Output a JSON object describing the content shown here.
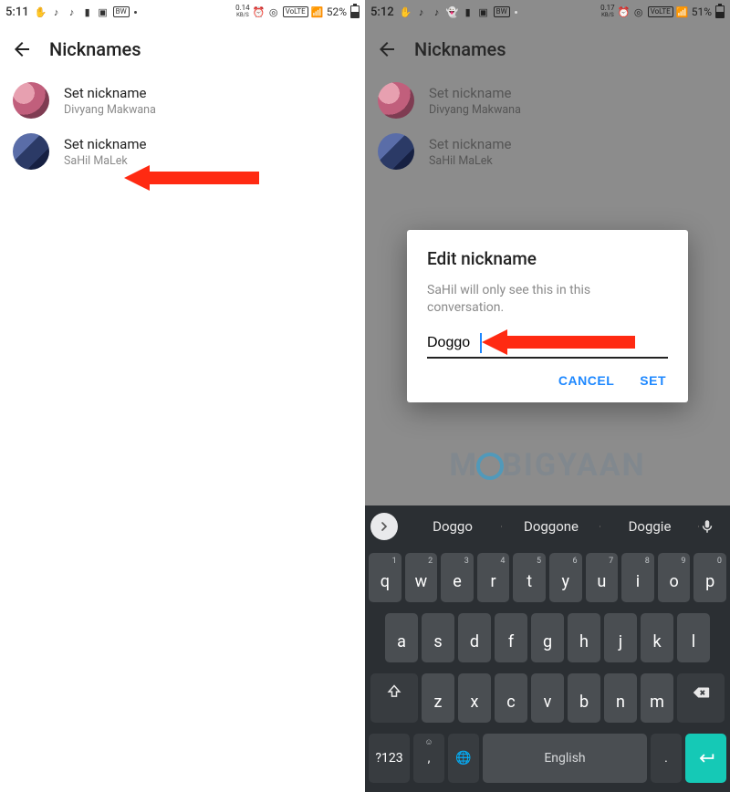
{
  "left": {
    "statusbar": {
      "time": "5:11",
      "rate": "0.14",
      "rate_unit": "KB/S",
      "volte": "VoLTE",
      "battery_pct": "52%",
      "bw": "BW"
    },
    "header": {
      "title": "Nicknames"
    },
    "rows": [
      {
        "title": "Set nickname",
        "sub": "Divyang Makwana"
      },
      {
        "title": "Set nickname",
        "sub": "SaHil MaLek"
      }
    ]
  },
  "right": {
    "statusbar": {
      "time": "5:12",
      "rate": "0.17",
      "rate_unit": "KB/S",
      "volte": "VoLTE",
      "battery_pct": "51%",
      "bw": "BW"
    },
    "header": {
      "title": "Nicknames"
    },
    "rows": [
      {
        "title": "Set nickname",
        "sub": "Divyang Makwana"
      },
      {
        "title": "Set nickname",
        "sub": "SaHil MaLek"
      }
    ],
    "dialog": {
      "title": "Edit nickname",
      "message": "SaHil will only see this in this conversation.",
      "input_value": "Doggo",
      "cancel": "CANCEL",
      "set": "SET"
    },
    "watermark": {
      "m": "M",
      "big": "BIGYAAN"
    },
    "keyboard": {
      "suggestions": [
        "Doggo",
        "Doggone",
        "Doggie"
      ],
      "row1": [
        "q",
        "w",
        "e",
        "r",
        "t",
        "y",
        "u",
        "i",
        "o",
        "p"
      ],
      "row1_hints": [
        "1",
        "2",
        "3",
        "4",
        "5",
        "6",
        "7",
        "8",
        "9",
        "0"
      ],
      "row2": [
        "a",
        "s",
        "d",
        "f",
        "g",
        "h",
        "j",
        "k",
        "l"
      ],
      "row3": [
        "z",
        "x",
        "c",
        "v",
        "b",
        "n",
        "m"
      ],
      "sym": "?123",
      "space": "English",
      "comma": ",",
      "period": ".",
      "emoji": "☺",
      "globe": "🌐"
    }
  }
}
